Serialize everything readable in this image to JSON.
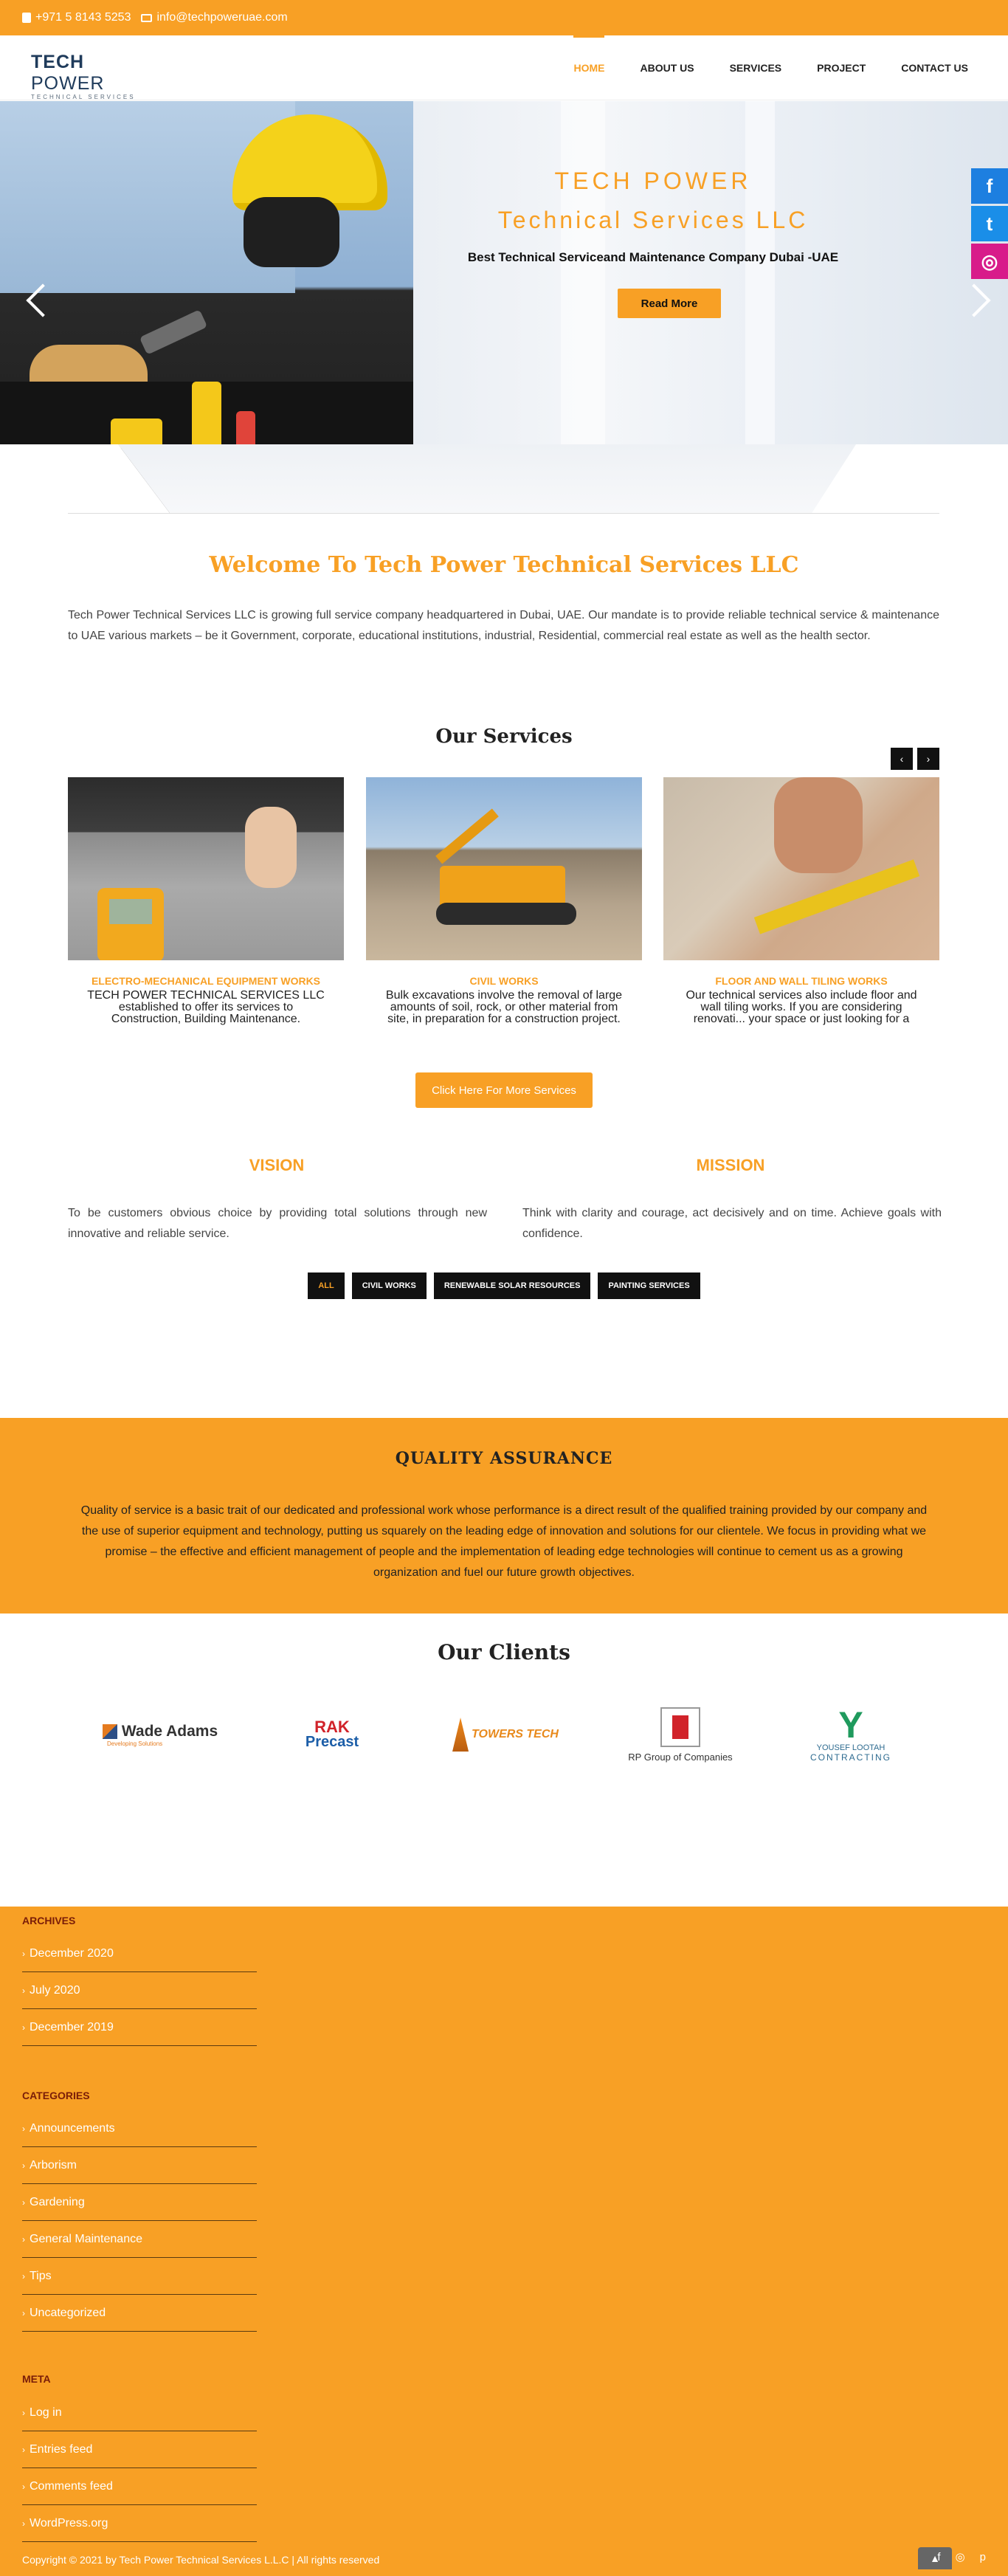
{
  "topbar": {
    "phone": "+971 5 8143 5253",
    "email": "info@techpoweruae.com"
  },
  "logo": {
    "line1_a": "TECH",
    "line1_b": "POWER",
    "line2": "TECHNICAL SERVICES L.L.C"
  },
  "nav": [
    {
      "label": "HOME",
      "active": true
    },
    {
      "label": "ABOUT US"
    },
    {
      "label": "SERVICES"
    },
    {
      "label": "PROJECT"
    },
    {
      "label": "CONTACT US"
    }
  ],
  "hero": {
    "title1": "TECH POWER",
    "title2": "Technical Services LLC",
    "subtitle": "Best Technical Serviceand Maintenance Company Dubai -UAE",
    "button": "Read More"
  },
  "social_side": {
    "facebook": "f",
    "twitter": "t",
    "instagram": "◎"
  },
  "welcome": {
    "title": "Welcome To Tech Power Technical Services LLC",
    "text": "Tech Power Technical Services LLC is growing full service company headquartered in Dubai, UAE. Our mandate is to provide reliable technical service & maintenance to UAE various markets – be it Government, corporate, educational institutions, industrial, Residential, commercial real estate as well as the health sector."
  },
  "services": {
    "title": "Our Services",
    "prev": "‹",
    "next": "›",
    "items": [
      {
        "title": "ELECTRO-MECHANICAL EQUIPMENT WORKS",
        "desc": "TECH POWER TECHNICAL SERVICES LLC established to offer its services to Construction, Building Maintenance."
      },
      {
        "title": "CIVIL WORKS",
        "desc": "Bulk excavations involve the removal of large amounts of soil, rock, or other material from site, in preparation for a construction project."
      },
      {
        "title": "FLOOR AND WALL TILING WORKS",
        "desc": "Our technical services also include floor and wall tiling works. If you are considering renovati... your space or just looking for a decorative finish,"
      }
    ],
    "more_button": "Click Here For More Services"
  },
  "vision": {
    "title": "VISION",
    "text": "To be customers obvious choice by providing total solutions through new innovative and reliable service."
  },
  "mission": {
    "title": "MISSION",
    "text": "Think with clarity and courage, act decisively and on time. Achieve goals with confidence."
  },
  "filters": [
    {
      "label": "ALL",
      "active": true
    },
    {
      "label": "CIVIL WORKS"
    },
    {
      "label": "RENEWABLE SOLAR RESOURCES"
    },
    {
      "label": "PAINTING SERVICES"
    }
  ],
  "quality": {
    "title": "QUALITY ASSURANCE",
    "text": "Quality of service is a basic trait of our dedicated and professional work whose performance is a direct result of the qualified training provided by our company and the use of superior equipment and technology, putting us squarely on the leading edge of innovation and solutions for our clientele. We focus in providing what we promise – the effective and efficient management of people and the implementation of leading edge technologies will continue to cement us as a growing organization and fuel our future growth objectives."
  },
  "clients": {
    "title": "Our Clients",
    "items": [
      {
        "name": "Wade Adams",
        "tagline": "Developing Solutions"
      },
      {
        "name_a": "RAK",
        "name_b": "Precast"
      },
      {
        "name": "TOWERS TECH"
      },
      {
        "name": "RP Group of Companies"
      },
      {
        "name_a": "YOUSEF LOOTAH",
        "name_b": "CONTRACTING"
      }
    ]
  },
  "footer": {
    "archives_title": "ARCHIVES",
    "archives": [
      "December 2020",
      "July 2020",
      "December 2019"
    ],
    "categories_title": "CATEGORIES",
    "categories": [
      "Announcements",
      "Arborism",
      "Gardening",
      "General Maintenance",
      "Tips",
      "Uncategorized"
    ],
    "meta_title": "META",
    "meta": [
      "Log in",
      "Entries feed",
      "Comments feed",
      "WordPress.org"
    ],
    "copyright": "Copyright © 2021 by Tech Power Technical Services L.L.C | All rights reserved",
    "social": {
      "facebook": "f",
      "instagram": "◎",
      "pinterest": "p"
    }
  },
  "colors": {
    "accent": "#f8a025",
    "footer_heading": "#7a1d08",
    "dark": "#111111"
  }
}
